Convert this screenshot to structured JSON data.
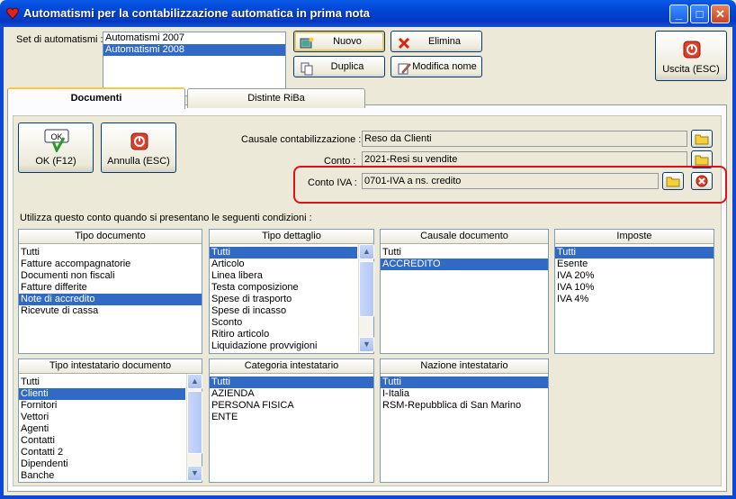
{
  "window": {
    "title": "Automatismi per la contabilizzazione automatica in prima nota",
    "controls": {
      "minimize": "_",
      "maximize": "□",
      "close": "✕"
    }
  },
  "set": {
    "label": "Set di automatismi :",
    "items": [
      "Automatismi 2007",
      "Automatismi 2008"
    ],
    "selected": 1
  },
  "toolbar": {
    "nuovo": "Nuovo",
    "elimina": "Elimina",
    "duplica": "Duplica",
    "modifica_nome": "Modifica nome",
    "uscita": "Uscita (ESC)"
  },
  "tabs": [
    {
      "label": "Documenti",
      "active": true
    },
    {
      "label": "Distinte RiBa",
      "active": false
    }
  ],
  "actions": {
    "ok": "OK (F12)",
    "ok_icon_text": "OK",
    "annulla": "Annulla (ESC)"
  },
  "form": {
    "causale_label": "Causale contabilizzazione :",
    "causale_value": "Reso da Clienti",
    "conto_label": "Conto :",
    "conto_value": "2021-Resi su vendite",
    "conto_iva_label": "Conto IVA :",
    "conto_iva_value": "0701-IVA a ns. credito"
  },
  "conditions_label": "Utilizza questo conto quando si presentano le seguenti condizioni :",
  "groups": {
    "tipo_documento": {
      "title": "Tipo documento",
      "items": [
        "Tutti",
        "Fatture accompagnatorie",
        "Documenti non fiscali",
        "Fatture differite",
        "Note di accredito",
        "Ricevute di cassa"
      ],
      "selected": [
        4
      ]
    },
    "tipo_dettaglio": {
      "title": "Tipo dettaglio",
      "items": [
        "Tutti",
        "Articolo",
        "Linea libera",
        "Testa composizione",
        "Spese di trasporto",
        "Spese di incasso",
        "Sconto",
        "Ritiro articolo",
        "Liquidazione provvigioni"
      ],
      "selected": [
        0
      ]
    },
    "causale_documento": {
      "title": "Causale documento",
      "items": [
        "Tutti",
        "ACCREDITO"
      ],
      "selected": [
        1
      ]
    },
    "imposte": {
      "title": "Imposte",
      "items": [
        "Tutti",
        "Esente",
        "IVA 20%",
        "IVA 10%",
        "IVA 4%"
      ],
      "selected": [
        0
      ]
    },
    "tipo_intestatario": {
      "title": "Tipo intestatario documento",
      "items": [
        "Tutti",
        "Clienti",
        "Fornitori",
        "Vettori",
        "Agenti",
        "Contatti",
        "Contatti 2",
        "Dipendenti",
        "Banche"
      ],
      "selected": [
        1
      ]
    },
    "categoria_intestatario": {
      "title": "Categoria intestatario",
      "items": [
        "Tutti",
        "AZIENDA",
        "PERSONA FISICA",
        "ENTE"
      ],
      "selected": [
        0
      ]
    },
    "nazione_intestatario": {
      "title": "Nazione intestatario",
      "items": [
        "Tutti",
        "I-Italia",
        "RSM-Repubblica di San Marino"
      ],
      "selected": [
        0
      ]
    }
  }
}
